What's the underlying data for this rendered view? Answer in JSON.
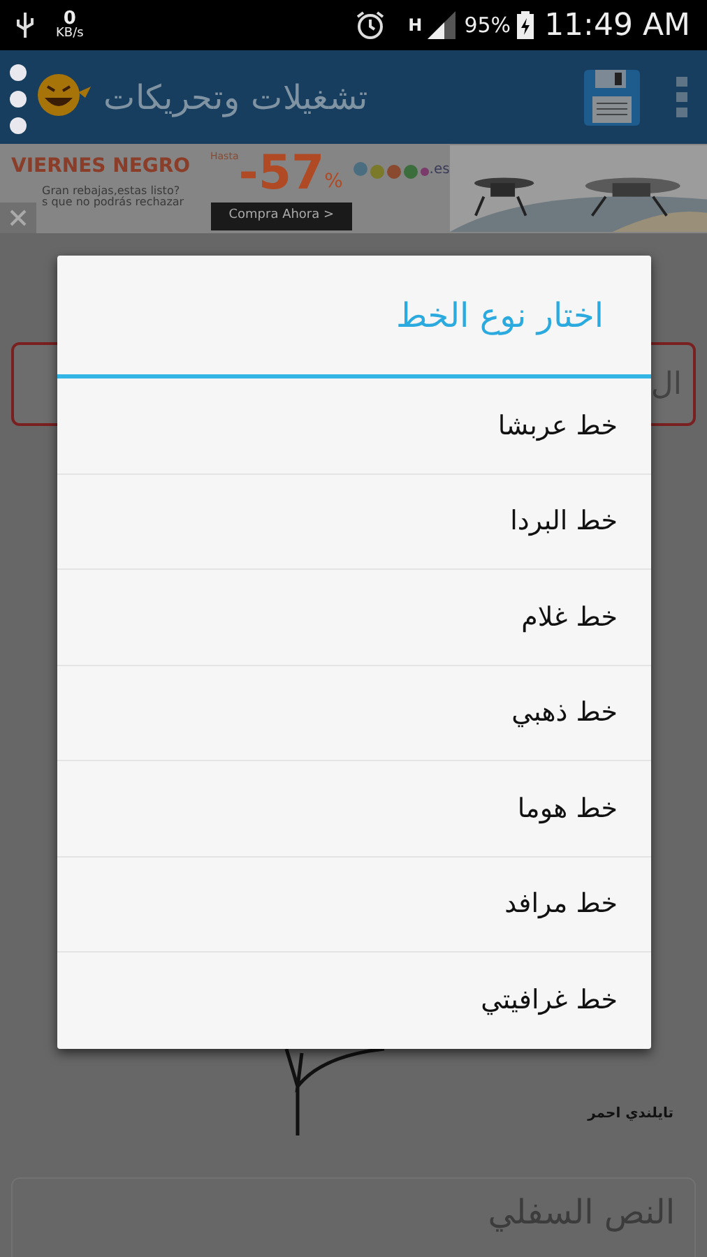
{
  "status_bar": {
    "data_rate": "0",
    "data_unit": "KB/s",
    "network": "H",
    "battery": "95%",
    "time": "11:49 AM"
  },
  "app_bar": {
    "title": "تشغيلات وتحريكات"
  },
  "ad": {
    "headline": "VIERNES NEGRO",
    "line_1": "Gran rebajas,estas listo?",
    "line_2": "s que no podrás rechazar",
    "prefix": "Hasta",
    "discount": "-57",
    "percent": "%",
    "brand_suffix": ".es",
    "button": "Compra Ahora >"
  },
  "top_field": {
    "text": "ال",
    "error": true
  },
  "canvas": {
    "caption": "تايلندي احمر"
  },
  "bottom_field": {
    "placeholder": "النص السفلي"
  },
  "dialog": {
    "title": "اختار نوع الخط",
    "options": [
      {
        "label": "خط عربشا"
      },
      {
        "label": "خط البردا"
      },
      {
        "label": "خط غلام"
      },
      {
        "label": "خط ذهبي"
      },
      {
        "label": "خط هوما"
      },
      {
        "label": "خط مرافد"
      },
      {
        "label": "خط غرافيتي"
      }
    ]
  }
}
